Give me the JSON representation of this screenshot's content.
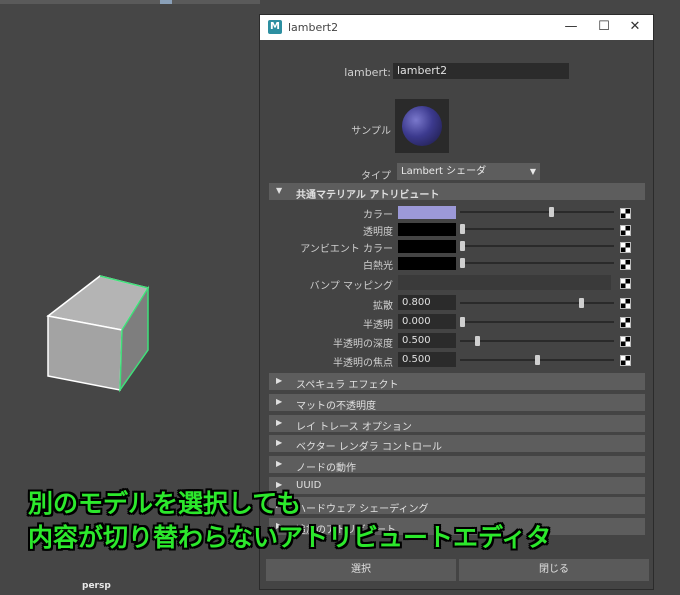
{
  "viewport": {
    "camera_label": "persp"
  },
  "window": {
    "title": "lambert2",
    "icon": "M",
    "controls": {
      "minimize": "—",
      "maximize": "☐",
      "close": "✕"
    }
  },
  "header": {
    "name_label": "lambert:",
    "name_value": "lambert2",
    "sample_label": "サンプル",
    "type_label": "タイプ",
    "type_value": "Lambert シェーダ"
  },
  "sections": {
    "common": "共通マテリアル アトリビュート",
    "collapsed": [
      "スペキュラ エフェクト",
      "マットの不透明度",
      "レイ トレース オプション",
      "ベクター レンダラ コントロール",
      "ノードの動作",
      "UUID",
      "ハードウェア シェーディング",
      "追加のアトリビュート"
    ]
  },
  "attributes": {
    "color": {
      "label": "カラー",
      "swatch": "#9c99d8",
      "slider": 0.6
    },
    "transparency": {
      "label": "透明度",
      "swatch": "#000000",
      "slider": 0
    },
    "ambient": {
      "label": "アンビエント カラー",
      "swatch": "#000000",
      "slider": 0
    },
    "incandescence": {
      "label": "白熱光",
      "swatch": "#000000",
      "slider": 0
    },
    "bump": {
      "label": "バンプ マッピング"
    },
    "diffuse": {
      "label": "拡散",
      "value": "0.800",
      "slider": 0.8
    },
    "translucence": {
      "label": "半透明",
      "value": "0.000",
      "slider": 0
    },
    "translucence_depth": {
      "label": "半透明の深度",
      "value": "0.500",
      "slider": 0.1
    },
    "translucence_focus": {
      "label": "半透明の焦点",
      "value": "0.500",
      "slider": 0.5
    }
  },
  "buttons": {
    "select": "選択",
    "close": "閉じる"
  },
  "caption": {
    "line1": "別のモデルを選択しても",
    "line2": "内容が切り替わらないアトリビュートエディタ"
  },
  "colors": {
    "caption": "#2ce82c",
    "cube_highlight": "#3fe07a"
  }
}
